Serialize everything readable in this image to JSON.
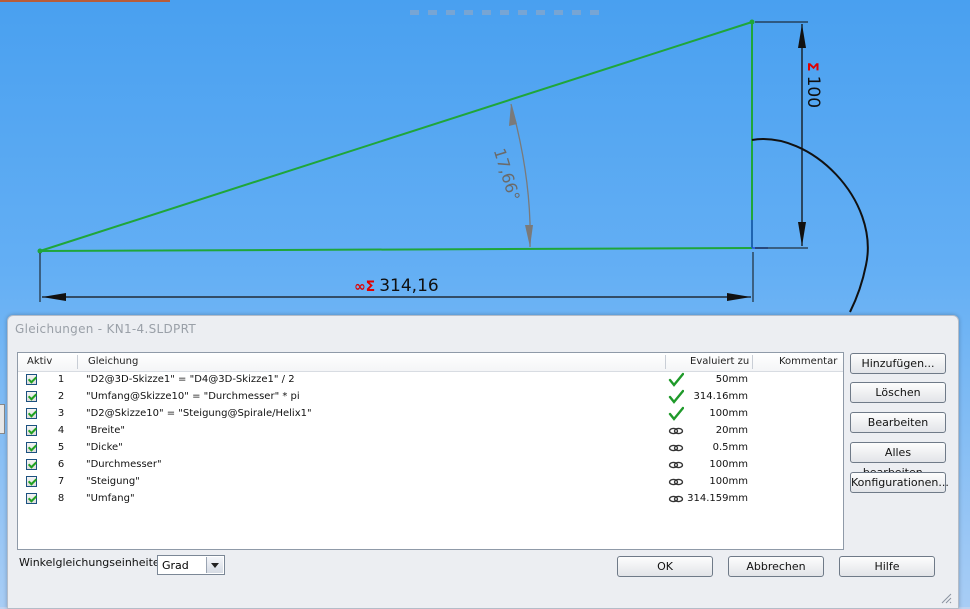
{
  "sketch": {
    "dim_bottom_value": "314,16",
    "dim_bottom_prefix": "∞Σ",
    "dim_right_value": "100",
    "dim_right_prefix": "Σ",
    "dim_angle_value": "17,66°",
    "line_color": "#1fa63a"
  },
  "dialog": {
    "title": "Gleichungen - KN1-4.SLDPRT",
    "columns": {
      "active": "Aktiv",
      "equation": "Gleichung",
      "evaluated": "Evaluiert zu",
      "comment": "Kommentar"
    },
    "rows": [
      {
        "num": "1",
        "equation": "\"D2@3D-Skizze1\" = \"D4@3D-Skizze1\" / 2",
        "status": "check-icon",
        "value": "50mm"
      },
      {
        "num": "2",
        "equation": "\"Umfang@Skizze10\" = \"Durchmesser\" * pi",
        "status": "check-icon",
        "value": "314.16mm"
      },
      {
        "num": "3",
        "equation": "\"D2@Skizze10\" = \"Steigung@Spirale/Helix1\"",
        "status": "check-icon",
        "value": "100mm"
      },
      {
        "num": "4",
        "equation": "\"Breite\"",
        "status": "link-icon",
        "value": "20mm"
      },
      {
        "num": "5",
        "equation": "\"Dicke\"",
        "status": "link-icon",
        "value": "0.5mm"
      },
      {
        "num": "6",
        "equation": "\"Durchmesser\"",
        "status": "link-icon",
        "value": "100mm"
      },
      {
        "num": "7",
        "equation": "\"Steigung\"",
        "status": "link-icon",
        "value": "100mm"
      },
      {
        "num": "8",
        "equation": "\"Umfang\"",
        "status": "link-icon",
        "value": "314.159mm"
      }
    ],
    "buttons": {
      "add": "Hinzufügen...",
      "delete": "Löschen",
      "edit": "Bearbeiten",
      "edit_all": "Alles bearbeiten...",
      "configs": "Konfigurationen...",
      "ok": "OK",
      "cancel": "Abbrechen",
      "help": "Hilfe"
    },
    "units_label": "Winkelgleichungseinheiten:",
    "units_value": "Grad"
  }
}
